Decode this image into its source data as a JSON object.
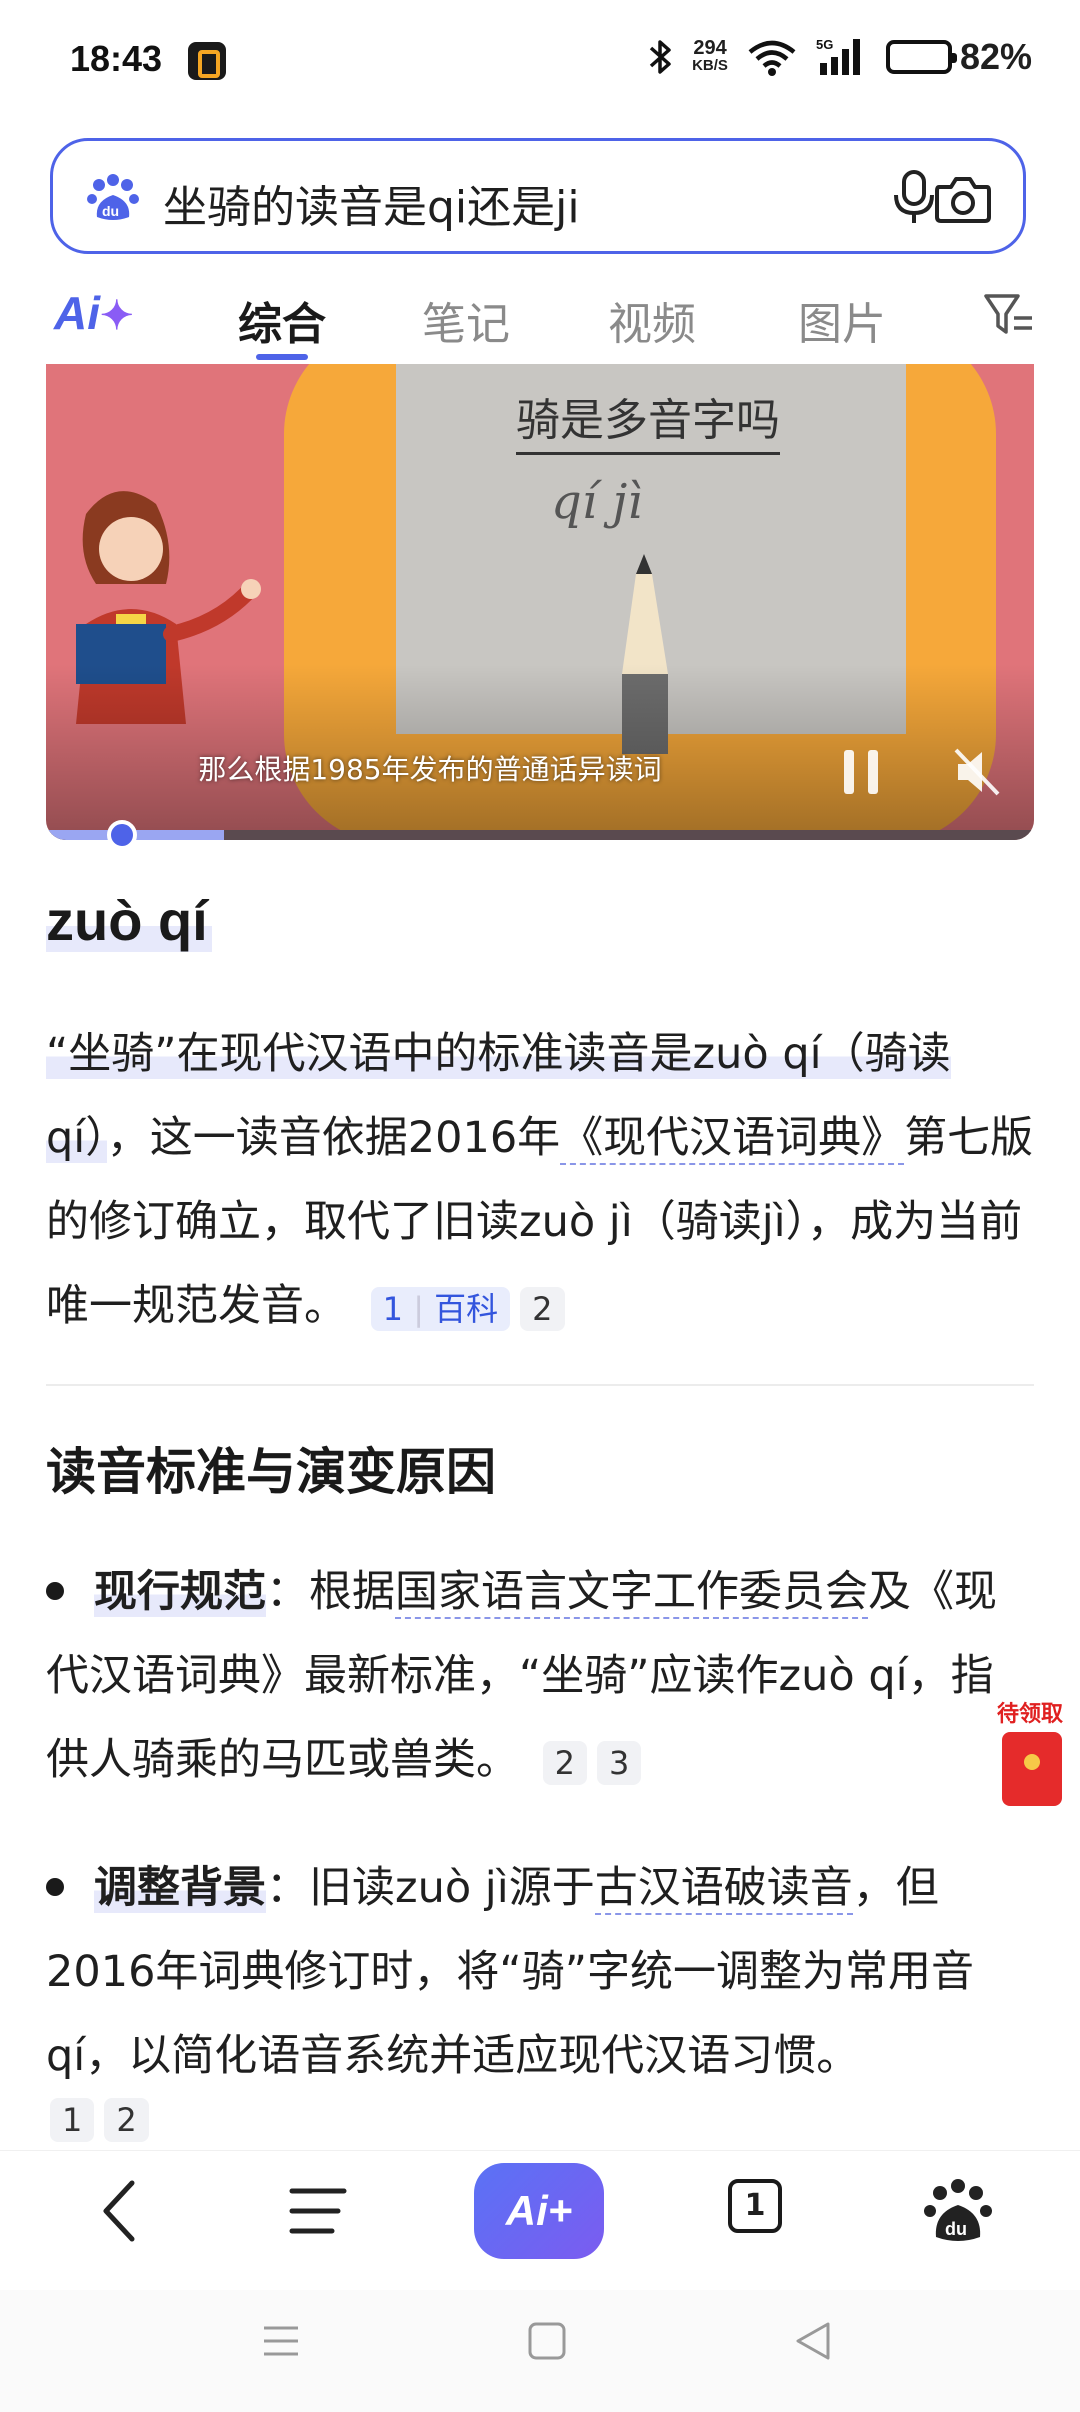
{
  "status_bar": {
    "time": "18:43",
    "net_speed_value": "294",
    "net_speed_unit": "KB/S",
    "network": "5G",
    "battery_percent": "82%",
    "battery_level": 0.82
  },
  "search": {
    "query": "坐骑的读音是qi还是ji"
  },
  "tabs": {
    "ai_label": "Ai",
    "items": [
      "综合",
      "笔记",
      "视频",
      "图片"
    ],
    "active_index": 0
  },
  "video": {
    "title": "骑是多音字吗",
    "pinyin": "qí jì",
    "subtitle": "那么根据1985年发布的普通话异读词",
    "progress_fraction": 0.1
  },
  "answer": {
    "title": "zuò qí",
    "p1_a": "“坐骑”在现代汉语中的标准读音是zuò qí（骑读qí）",
    "p1_b": "，这一读音依据2016年",
    "p1_c": "《现代汉语词典》",
    "p1_d": "第七版的修订确立，取代了旧读zuò jì（骑读jì），成为当前唯一规范发音。",
    "cite_1": "1",
    "cite_1_label": "百科",
    "cite_2": "2"
  },
  "section": {
    "title": "读音标准与演变原因",
    "bullet1_label": "现行规范",
    "bullet1_a": "：根据",
    "bullet1_link": "国家语言文字工作委员会",
    "bullet1_b": "及《现代汉语词典》最新标准，“坐骑”应读作zuò qí，指供人骑乘的马匹或兽类。",
    "bullet1_cites": [
      "2",
      "3"
    ],
    "bullet2_label": "调整背景",
    "bullet2_a": "：旧读zuò jì源于",
    "bullet2_link": "古汉语破读音",
    "bullet2_b": "，但2016年词典修订时，将“骑”字统一调整为常用音qí，以简化语音系统并适应现代汉语习惯。",
    "bullet2_cites": [
      "1",
      "2"
    ]
  },
  "red_packet": {
    "label": "待领取"
  },
  "bottom_nav": {
    "ai_label": "Ai+",
    "tab_count": "1"
  },
  "colors": {
    "accent": "#4e63e8",
    "highlight": "#e7e9fb",
    "video_bg": "#e0747a",
    "video_frame": "#f6a83a"
  }
}
